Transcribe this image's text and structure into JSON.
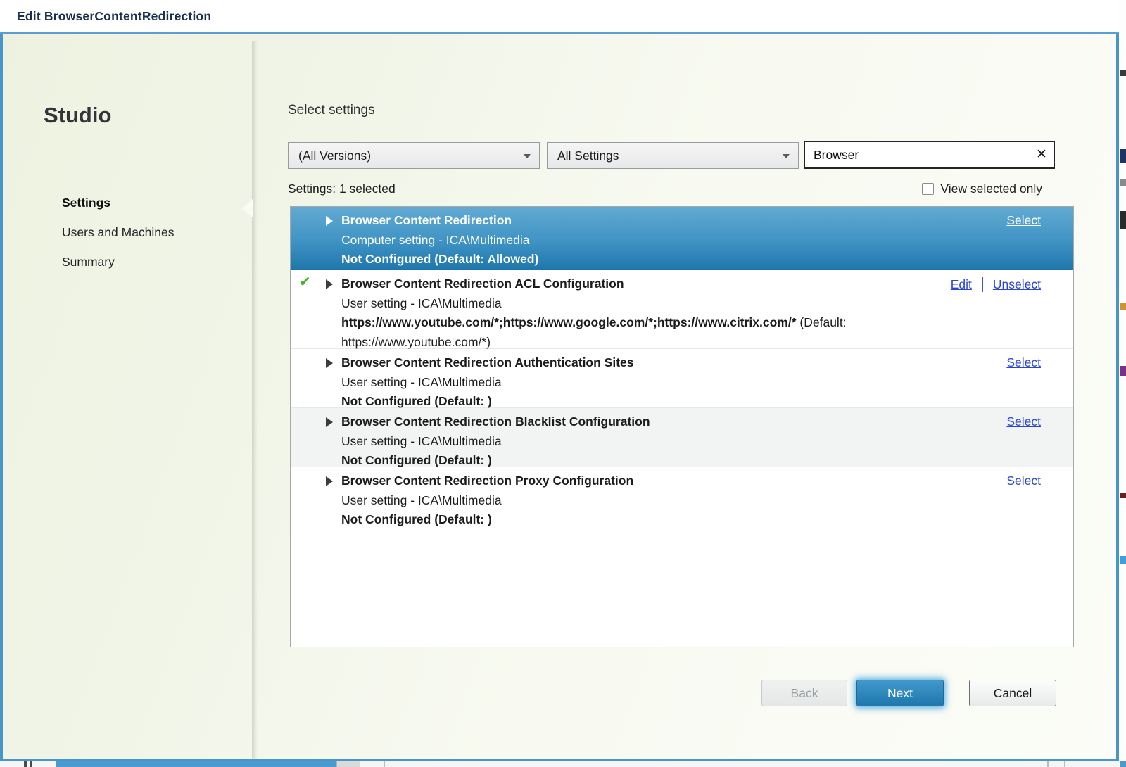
{
  "window": {
    "title": "Edit BrowserContentRedirection"
  },
  "sidebar": {
    "brand": "Studio",
    "items": [
      {
        "label": "Settings",
        "active": true
      },
      {
        "label": "Users and Machines",
        "active": false
      },
      {
        "label": "Summary",
        "active": false
      }
    ]
  },
  "content": {
    "heading": "Select settings",
    "filters": {
      "version_dropdown": "(All Versions)",
      "category_dropdown": "All Settings",
      "search": {
        "value": "Browser"
      }
    },
    "selected_count": "Settings: 1 selected",
    "view_selected_only": "View selected only",
    "settings_list": [
      {
        "title": "Browser Content Redirection",
        "scope": "Computer setting - ICA\\Multimedia",
        "value_bold": "Not Configured (Default: Allowed)",
        "value_rest": "",
        "actions": [
          "Select"
        ]
      },
      {
        "title": "Browser Content Redirection ACL Configuration",
        "scope": "User setting - ICA\\Multimedia",
        "value_bold": "https://www.youtube.com/*;https://www.google.com/*;https://www.citrix.com/*",
        "value_rest": " (Default: https://www.youtube.com/*)",
        "actions": [
          "Edit",
          "Unselect"
        ]
      },
      {
        "title": "Browser Content Redirection Authentication Sites",
        "scope": "User setting - ICA\\Multimedia",
        "value_bold": "Not Configured (Default: )",
        "value_rest": "",
        "actions": [
          "Select"
        ]
      },
      {
        "title": "Browser Content Redirection Blacklist Configuration",
        "scope": "User setting - ICA\\Multimedia",
        "value_bold": "Not Configured (Default: )",
        "value_rest": "",
        "actions": [
          "Select"
        ]
      },
      {
        "title": "Browser Content Redirection Proxy Configuration",
        "scope": "User setting - ICA\\Multimedia",
        "value_bold": "Not Configured (Default: )",
        "value_rest": "",
        "actions": [
          "Select"
        ]
      }
    ],
    "buttons": {
      "back": "Back",
      "next": "Next",
      "cancel": "Cancel"
    }
  },
  "icons": {
    "check": "✔",
    "clear": "✕"
  },
  "theme": {
    "accent_blue": "#4795cb",
    "selection_top": "#62aad2",
    "selection_bottom": "#1e77ac",
    "link_blue": "#2946cf",
    "check_green": "#46b428",
    "disabled_text": "#9aa0a5"
  }
}
